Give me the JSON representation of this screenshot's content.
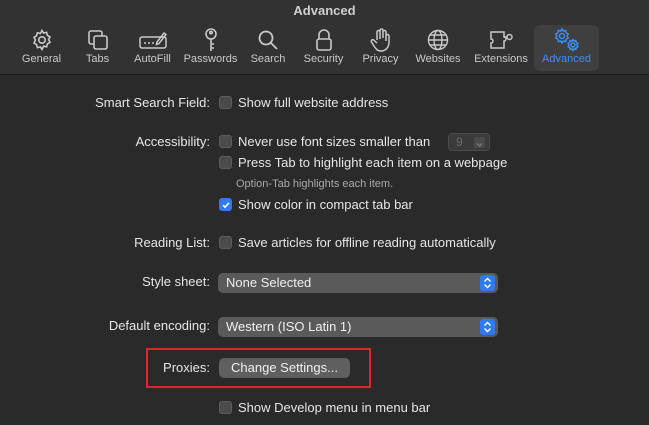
{
  "window": {
    "title": "Advanced"
  },
  "toolbar": {
    "items": [
      {
        "label": "General",
        "icon": "gear-icon"
      },
      {
        "label": "Tabs",
        "icon": "tabs-icon"
      },
      {
        "label": "AutoFill",
        "icon": "pencil-field-icon"
      },
      {
        "label": "Passwords",
        "icon": "key-icon"
      },
      {
        "label": "Search",
        "icon": "magnifier-icon"
      },
      {
        "label": "Security",
        "icon": "lock-icon"
      },
      {
        "label": "Privacy",
        "icon": "hand-icon"
      },
      {
        "label": "Websites",
        "icon": "globe-icon"
      },
      {
        "label": "Extensions",
        "icon": "puzzle-icon"
      },
      {
        "label": "Advanced",
        "icon": "gears-icon"
      }
    ],
    "selected": "Advanced",
    "accent": "#3d8ff0"
  },
  "settings": {
    "smart_search": {
      "label": "Smart Search Field:",
      "option": "Show full website address",
      "checked": false
    },
    "accessibility": {
      "label": "Accessibility:",
      "min_font": {
        "text": "Never use font sizes smaller than",
        "checked": false,
        "value": "9"
      },
      "tab_highlight": {
        "text": "Press Tab to highlight each item on a webpage",
        "checked": false
      },
      "hint": "Option-Tab highlights each item.",
      "compact_color": {
        "text": "Show color in compact tab bar",
        "checked": true
      }
    },
    "reading_list": {
      "label": "Reading List:",
      "option": "Save articles for offline reading automatically",
      "checked": false
    },
    "style_sheet": {
      "label": "Style sheet:",
      "value": "None Selected"
    },
    "encoding": {
      "label": "Default encoding:",
      "value": "Western (ISO Latin 1)"
    },
    "proxies": {
      "label": "Proxies:",
      "button": "Change Settings..."
    },
    "develop": {
      "option": "Show Develop menu in menu bar",
      "checked": false
    }
  },
  "colors": {
    "checkbox_on": "#2f7bf5",
    "highlight_box": "#e3262b"
  }
}
